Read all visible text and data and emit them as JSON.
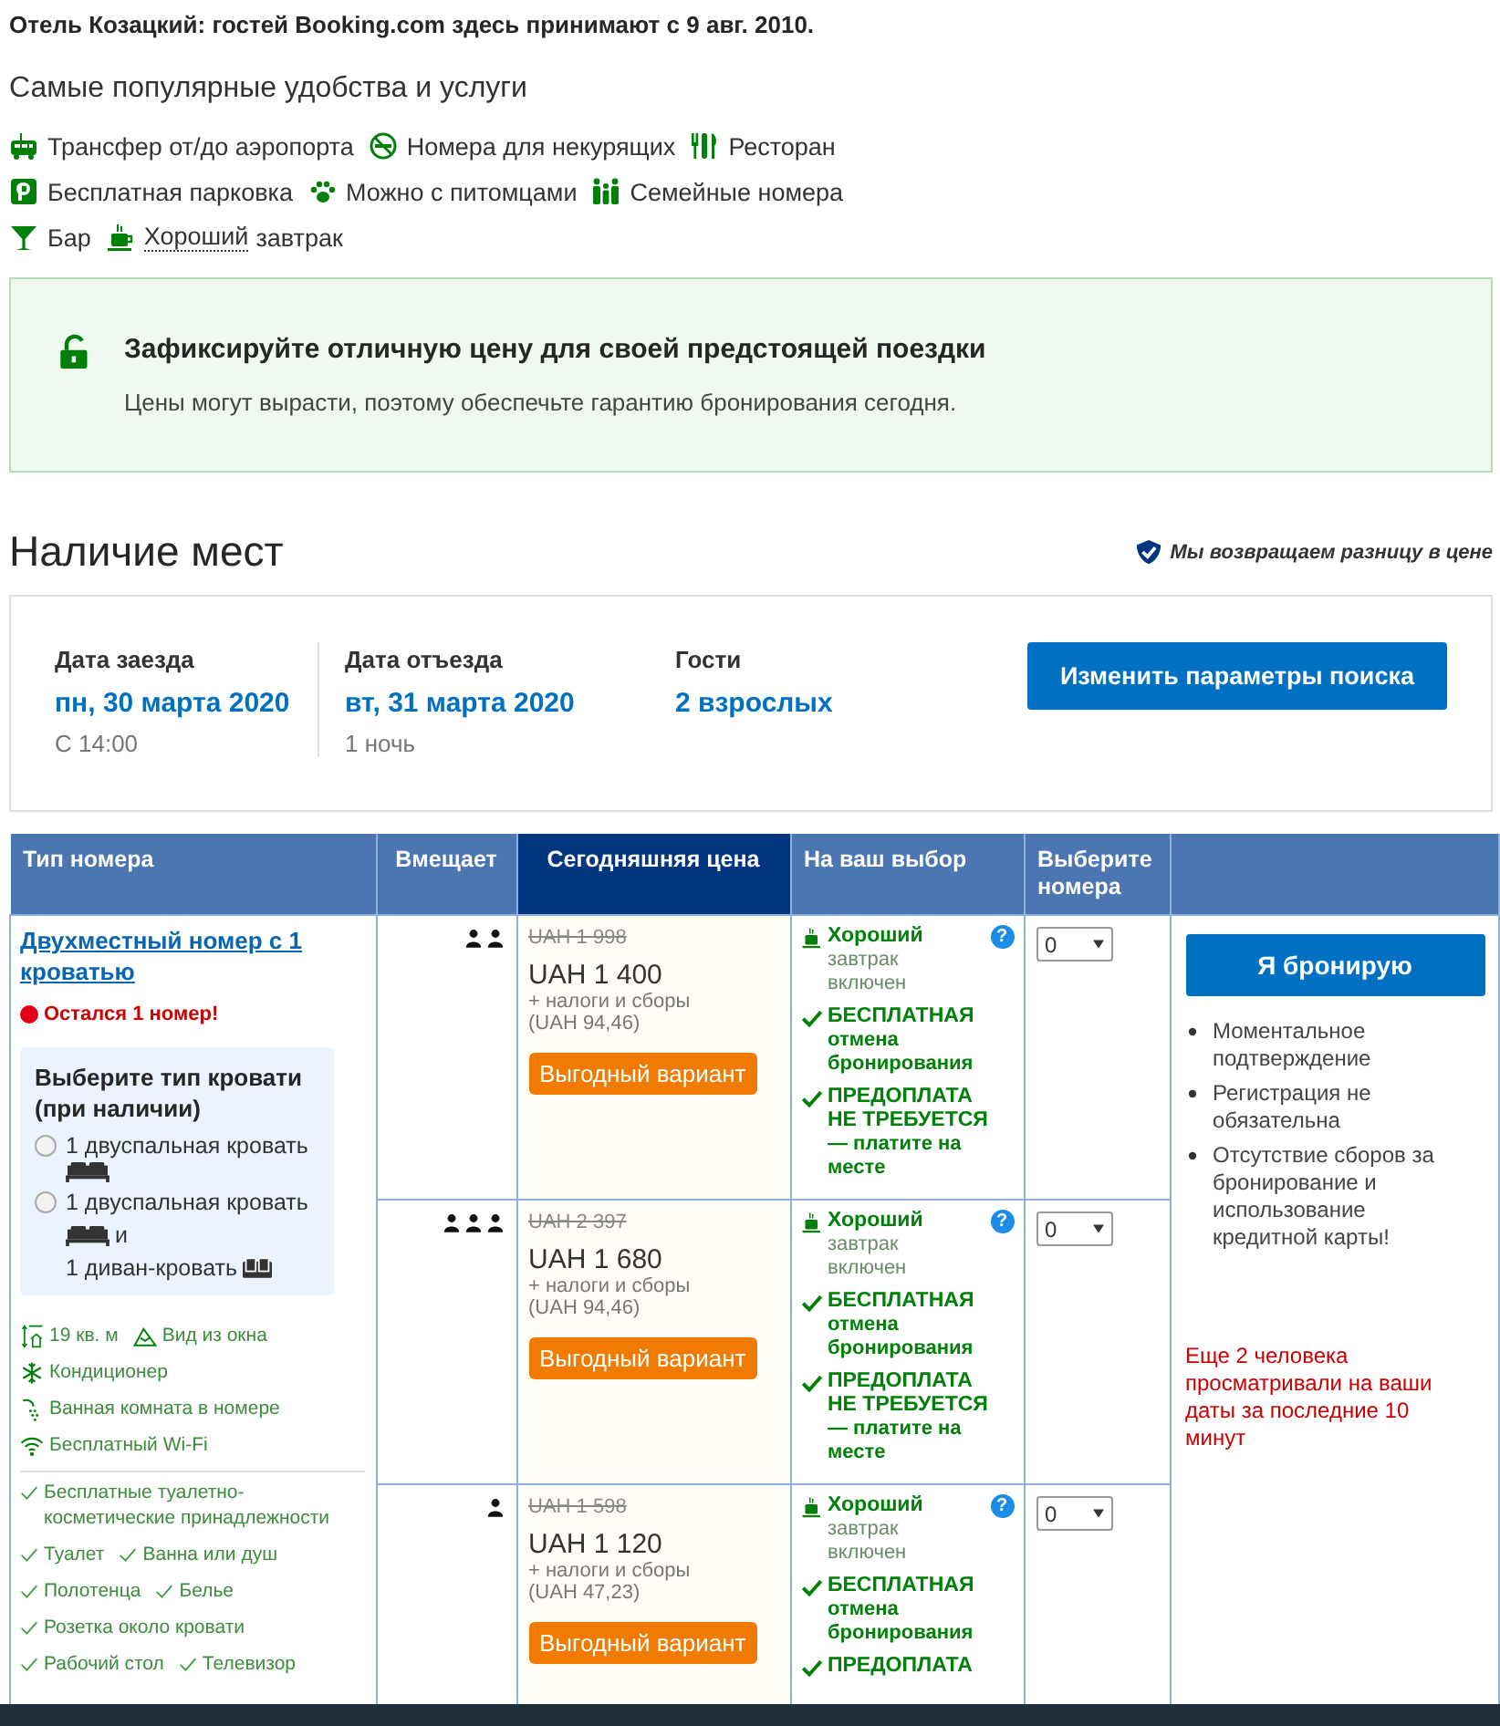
{
  "header_note": "Отель Козацкий: гостей Booking.com здесь принимают с 9 авг. 2010.",
  "facilities": {
    "title": "Самые популярные удобства и услуги",
    "items": [
      {
        "kind": "shuttle",
        "label": "Трансфер от/до аэропорта"
      },
      {
        "kind": "nosmoking",
        "label": "Номера для некурящих"
      },
      {
        "kind": "restaurant",
        "label": "Ресторан"
      },
      {
        "kind": "parking",
        "label": "Бесплатная парковка"
      },
      {
        "kind": "paw",
        "label": "Можно с питомцами"
      },
      {
        "kind": "family",
        "label": "Семейные номера"
      },
      {
        "kind": "bar",
        "label": "Бар"
      },
      {
        "kind": "breakfast",
        "link": "Хороший",
        "label": "завтрак"
      }
    ]
  },
  "promo": {
    "title": "Зафиксируйте отличную цену для своей предстоящей поездки",
    "text": "Цены могут вырасти, поэтому обеспечьте гарантию бронирования сегодня."
  },
  "availability": {
    "title": "Наличие мест",
    "price_match": "Мы возвращаем разницу в цене"
  },
  "search": {
    "fields": [
      {
        "label": "Дата заезда",
        "value": "пн, 30 марта 2020",
        "note": "С 14:00"
      },
      {
        "label": "Дата отъезда",
        "value": "вт, 31 марта 2020",
        "note": "1 ночь"
      },
      {
        "label": "Гости",
        "value": "2 взрослых"
      }
    ],
    "button": "Изменить параметры поиска"
  },
  "table": {
    "columns": [
      "Тип номера",
      "Вмещает",
      "Сегодняшняя цена",
      "На ваш выбор",
      "Выберите номера"
    ],
    "room": {
      "name": "Двухместный номер с 1 кроватью",
      "scarcity": "Остался 1 номер!",
      "bed_choice": {
        "title": "Выберите тип кровати (при наличии)",
        "options": [
          {
            "selected": false,
            "lines": [
              [
                {
                  "kind": "text",
                  "text": "1 двуспальная кровать"
                }
              ],
              [
                {
                  "kind": "bed"
                }
              ]
            ]
          },
          {
            "selected": false,
            "lines": [
              [
                {
                  "kind": "text",
                  "text": "1 двуспальная кровать"
                }
              ],
              [
                {
                  "kind": "bed"
                },
                {
                  "kind": "text",
                  "text": "и"
                }
              ],
              [
                {
                  "kind": "text",
                  "text": "1 диван-кровать"
                },
                {
                  "kind": "sofa"
                }
              ]
            ]
          }
        ]
      },
      "features": [
        [
          {
            "kind": "size",
            "text": "19 кв. м"
          },
          {
            "kind": "view",
            "text": "Вид из окна"
          }
        ],
        [
          {
            "kind": "snow",
            "text": "Кондиционер"
          }
        ],
        [
          {
            "kind": "bath",
            "text": "Ванная комната в номере"
          }
        ],
        [
          {
            "kind": "wifi",
            "text": "Бесплатный Wi-Fi"
          }
        ]
      ],
      "amenities": [
        [
          "Бесплатные туалетно-косметические принадлежности"
        ],
        [
          "Туалет",
          "Ванна или душ"
        ],
        [
          "Полотенца",
          "Белье"
        ],
        [
          "Розетка около кровати"
        ],
        [
          "Рабочий стол",
          "Телевизор"
        ]
      ]
    },
    "offers": [
      {
        "capacity": [
          {
            "kind": "person"
          },
          {
            "kind": "person"
          }
        ],
        "old_price": "UAH 1 998",
        "price": "UAH 1 400",
        "taxes": "+ налоги и сборы",
        "tax_amount": "(UAH 94,46)",
        "deal": "Выгодный вариант",
        "quantity": "0",
        "conditions": [
          {
            "kind": "meal",
            "title": "Хороший",
            "text": "завтрак включен",
            "help": "?"
          },
          {
            "kind": "check",
            "title": "БЕСПЛАТНАЯ",
            "text": "отмена бронирования"
          },
          {
            "kind": "check",
            "title": "ПРЕДОПЛАТА НЕ ТРЕБУЕТСЯ",
            "text": "— платите на месте"
          }
        ]
      },
      {
        "capacity": [
          {
            "kind": "person"
          },
          {
            "kind": "person"
          },
          {
            "kind": "person"
          }
        ],
        "old_price": "UAH 2 397",
        "price": "UAH 1 680",
        "taxes": "+ налоги и сборы",
        "tax_amount": "(UAH 94,46)",
        "deal": "Выгодный вариант",
        "quantity": "0",
        "conditions": [
          {
            "kind": "meal",
            "title": "Хороший",
            "text": "завтрак включен",
            "help": "?"
          },
          {
            "kind": "check",
            "title": "БЕСПЛАТНАЯ",
            "text": "отмена бронирования"
          },
          {
            "kind": "check",
            "title": "ПРЕДОПЛАТА НЕ ТРЕБУЕТСЯ",
            "text": "— платите на месте"
          }
        ]
      },
      {
        "capacity": [
          {
            "kind": "person"
          }
        ],
        "old_price": "UAH 1 598",
        "price": "UAH 1 120",
        "taxes": "+ налоги и сборы",
        "tax_amount": "(UAH 47,23)",
        "deal": "Выгодный вариант",
        "quantity": "0",
        "conditions": [
          {
            "kind": "meal",
            "title": "Хороший",
            "text": "завтрак включен",
            "help": "?"
          },
          {
            "kind": "check",
            "title": "БЕСПЛАТНАЯ",
            "text": "отмена бронирования"
          },
          {
            "kind": "check",
            "title": "ПРЕДОПЛАТА"
          }
        ]
      }
    ],
    "booking": {
      "button": "Я бронирую",
      "benefits": [
        "Моментальное подтверждение",
        "Регистрация не обязательна",
        "Отсутствие сборов за бронирование и использование кредитной карты!"
      ],
      "notice": "Еще 2 человека просматривали на ваши даты за последние 10 минут"
    }
  }
}
